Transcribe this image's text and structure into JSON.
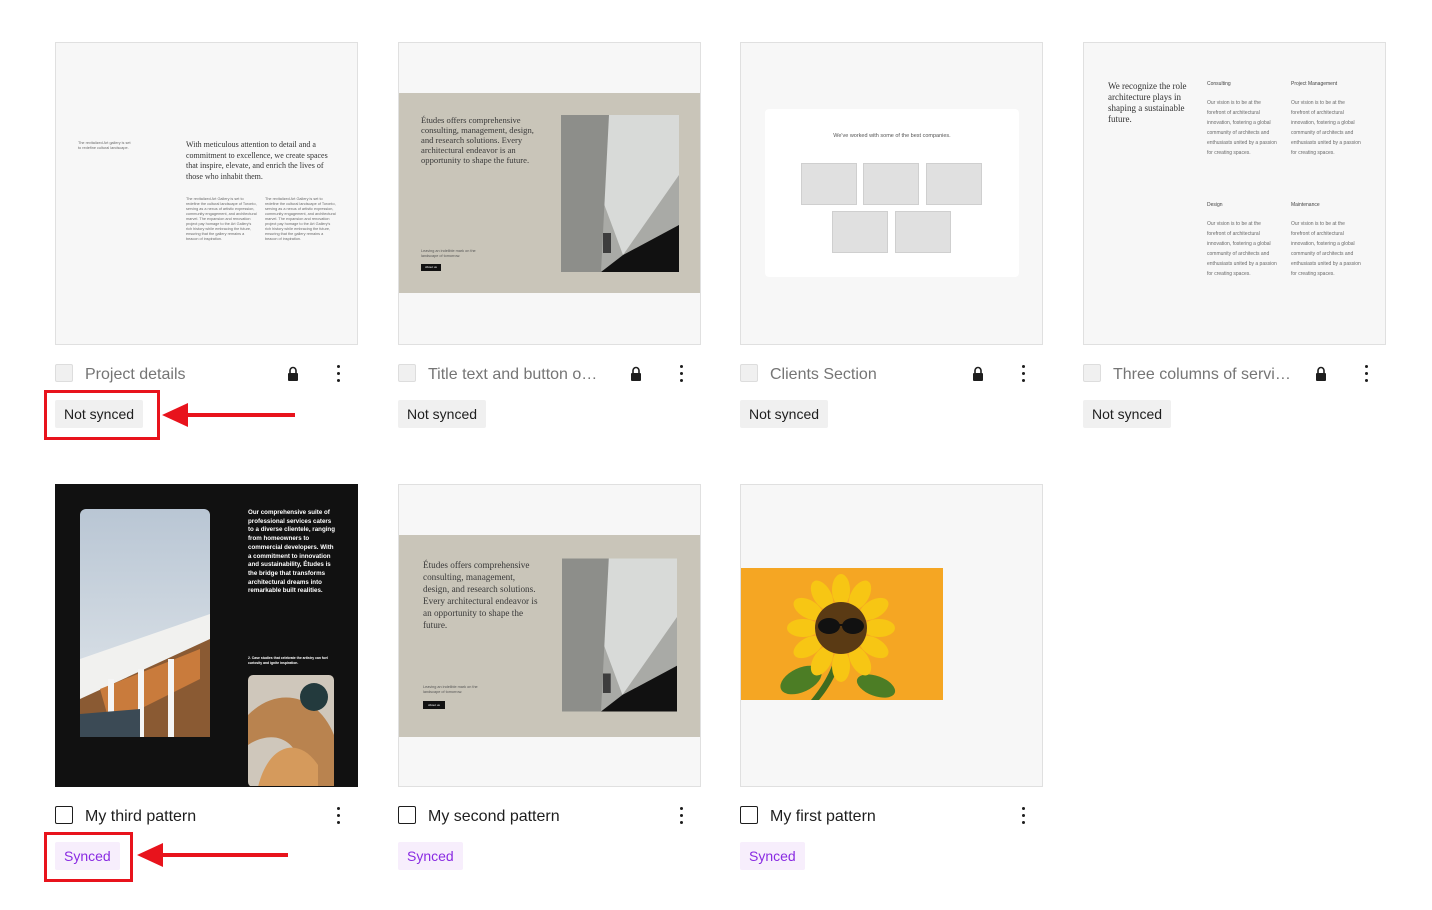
{
  "patterns": [
    {
      "title": "Project details",
      "status": "Not synced",
      "locked": true,
      "preview": {
        "small_left": "The revitalized Art gallery is set to redefine cultural landscape.",
        "heading": "With meticulous attention to detail and a commitment to excellence, we create spaces that inspire, elevate, and enrich the lives of those who inhabit them.",
        "col_text": "The revitalized Art Gallery is set to redefine the cultural landscape of Toronto, serving as a nexus of artistic expression, community engagement, and architectural marvel. The expansion and renovation project pay homage to the Art Gallery's rich history while embracing the future, ensuring that the gallery remains a beacon of inspiration."
      }
    },
    {
      "title": "Title text and button o…",
      "status": "Not synced",
      "locked": true,
      "preview": {
        "heading": "Études offers comprehensive consulting, management, design, and research solutions. Every architectural endeavor is an opportunity to shape the future.",
        "small": "Leaving an indelible mark on the landscape of tomorrow.",
        "button": "About us"
      }
    },
    {
      "title": "Clients Section",
      "status": "Not synced",
      "locked": true,
      "preview": {
        "heading": "We've worked with some of the best companies."
      }
    },
    {
      "title": "Three columns of servi…",
      "status": "Not synced",
      "locked": true,
      "preview": {
        "heading": "We recognize the role architecture plays in shaping a sustainable future.",
        "services": [
          {
            "name": "Consulting",
            "text": "Our vision is to be at the forefront of architectural innovation, fostering a global community of architects and enthusiasts united by a passion for creating spaces."
          },
          {
            "name": "Project Management",
            "text": "Our vision is to be at the forefront of architectural innovation, fostering a global community of architects and enthusiasts united by a passion for creating spaces."
          },
          {
            "name": "Design",
            "text": "Our vision is to be at the forefront of architectural innovation, fostering a global community of architects and enthusiasts united by a passion for creating spaces."
          },
          {
            "name": "Maintenance",
            "text": "Our vision is to be at the forefront of architectural innovation, fostering a global community of architects and enthusiasts united by a passion for creating spaces."
          }
        ]
      }
    },
    {
      "title": "My third pattern",
      "status": "Synced",
      "locked": false,
      "preview": {
        "heading": "Our comprehensive suite of professional services caters to a diverse clientele, ranging from homeowners to commercial developers. With a commitment to innovation and sustainability, Études is the bridge that transforms architectural dreams into remarkable built realities.",
        "caption": "2. Case studies that celebrate the artistry can fuel curiosity and ignite inspiration."
      }
    },
    {
      "title": "My second pattern",
      "status": "Synced",
      "locked": false,
      "preview": {
        "heading": "Études offers comprehensive consulting, management, design, and research solutions. Every architectural endeavor is an opportunity to shape the future.",
        "small": "Leaving an indelible mark on the landscape of tomorrow.",
        "button": "About us"
      }
    },
    {
      "title": "My first pattern",
      "status": "Synced",
      "locked": false,
      "preview": {}
    }
  ],
  "colors": {
    "highlight": "#e8131c",
    "synced_text": "#8a2be2",
    "synced_bg": "#f7eefc",
    "not_synced_bg": "#f0f0f0",
    "preview_beige": "#c9c5b9",
    "preview_dark": "#111111",
    "sunflower_bg": "#f5a623"
  }
}
